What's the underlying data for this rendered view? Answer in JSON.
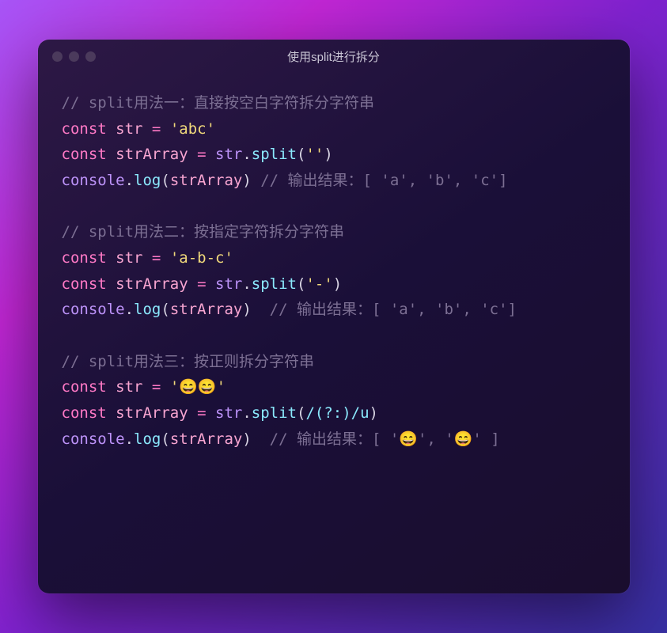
{
  "window": {
    "title": "使用split进行拆分"
  },
  "code": {
    "c1": "// split用法一：直接按空白字符拆分字符串",
    "l1_kw": "const",
    "l1_var": "str",
    "l1_eq": " = ",
    "l1_str": "'abc'",
    "l2_kw": "const",
    "l2_var": "strArray",
    "l2_eq": " = ",
    "l2_obj": "str",
    "l2_dot": ".",
    "l2_fn": "split",
    "l2_op": "(",
    "l2_arg": "''",
    "l2_cp": ")",
    "l3_obj": "console",
    "l3_dot": ".",
    "l3_fn": "log",
    "l3_op": "(",
    "l3_arg": "strArray",
    "l3_cp": ")",
    "l3_cmt": " // 输出结果：[ 'a', 'b', 'c']",
    "c2": "// split用法二：按指定字符拆分字符串",
    "l4_kw": "const",
    "l4_var": "str",
    "l4_eq": " = ",
    "l4_str": "'a-b-c'",
    "l5_kw": "const",
    "l5_var": "strArray",
    "l5_eq": " = ",
    "l5_obj": "str",
    "l5_dot": ".",
    "l5_fn": "split",
    "l5_op": "(",
    "l5_arg": "'-'",
    "l5_cp": ")",
    "l6_obj": "console",
    "l6_dot": ".",
    "l6_fn": "log",
    "l6_op": "(",
    "l6_arg": "strArray",
    "l6_cp": ")",
    "l6_cmt": "  // 输出结果：[ 'a', 'b', 'c']",
    "c3": "// split用法三：按正则拆分字符串",
    "l7_kw": "const",
    "l7_var": "str",
    "l7_eq": " = ",
    "l7_str": "'😄😄'",
    "l8_kw": "const",
    "l8_var": "strArray",
    "l8_eq": " = ",
    "l8_obj": "str",
    "l8_dot": ".",
    "l8_fn": "split",
    "l8_op": "(",
    "l8_rx": "/(?:)/u",
    "l8_cp": ")",
    "l9_obj": "console",
    "l9_dot": ".",
    "l9_fn": "log",
    "l9_op": "(",
    "l9_arg": "strArray",
    "l9_cp": ")",
    "l9_cmt": "  // 输出结果：[ '😄', '😄' ]"
  }
}
